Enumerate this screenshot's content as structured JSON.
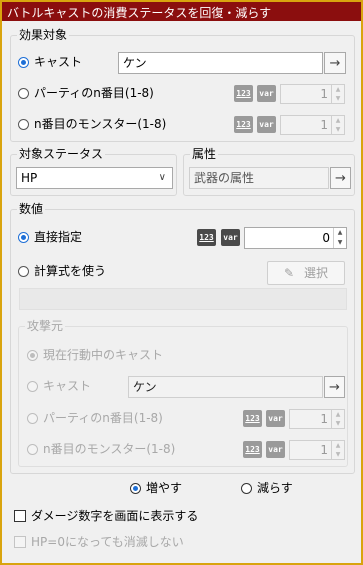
{
  "window": {
    "title": "バトルキャストの消費ステータスを回復・減らす"
  },
  "target_group": {
    "legend": "効果対象",
    "options": [
      {
        "label": "キャスト",
        "selected": true
      },
      {
        "label": "パーティのn番目(1-8)",
        "selected": false
      },
      {
        "label": "n番目のモンスター(1-8)",
        "selected": false
      }
    ],
    "cast_value": "ケン",
    "party_index": "1",
    "monster_index": "1"
  },
  "status_group": {
    "legend": "対象ステータス",
    "selected": "HP"
  },
  "attribute_group": {
    "legend": "属性",
    "value": "武器の属性"
  },
  "value_group": {
    "legend": "数値",
    "direct": {
      "label": "直接指定",
      "value": "0",
      "selected": true
    },
    "formula": {
      "label": "計算式を使う",
      "select_button": "選択",
      "selected": false
    },
    "attacker": {
      "legend": "攻撃元",
      "options": [
        {
          "label": "現在行動中のキャスト",
          "selected": true
        },
        {
          "label": "キャスト",
          "selected": false
        },
        {
          "label": "パーティのn番目(1-8)",
          "selected": false
        },
        {
          "label": "n番目のモンスター(1-8)",
          "selected": false
        }
      ],
      "cast_value": "ケン",
      "party_index": "1",
      "monster_index": "1"
    }
  },
  "operation": {
    "increase": {
      "label": "増やす",
      "selected": true
    },
    "decrease": {
      "label": "減らす",
      "selected": false
    }
  },
  "options": {
    "show_damage": {
      "label": "ダメージ数字を画面に表示する",
      "checked": false
    },
    "no_vanish": {
      "label": "HP=0になっても消滅しない",
      "checked": false
    }
  },
  "icons": {
    "number": "123",
    "variable": "var",
    "arrow": "→",
    "pencil": "✎",
    "chevron": "∨"
  }
}
